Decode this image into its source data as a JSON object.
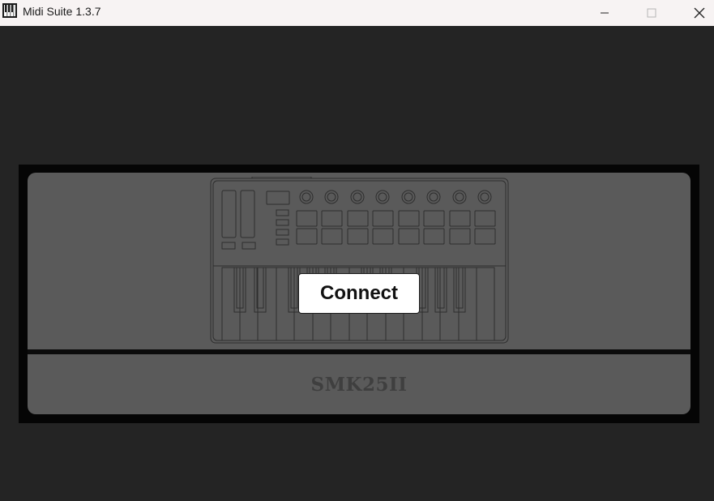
{
  "window": {
    "title": "Midi Suite 1.3.7",
    "icon": "piano-keys-icon",
    "controls": {
      "minimize": "minimize-icon",
      "maximize": "maximize-icon",
      "close": "close-icon"
    }
  },
  "device": {
    "name": "SMK25II",
    "illustration": "midi-keyboard-controller",
    "connect_label": "Connect"
  },
  "colors": {
    "background": "#242424",
    "card": "#5a5a5a",
    "frame": "#050505",
    "titlebar": "#f7f3f3",
    "button": "#ffffff"
  }
}
